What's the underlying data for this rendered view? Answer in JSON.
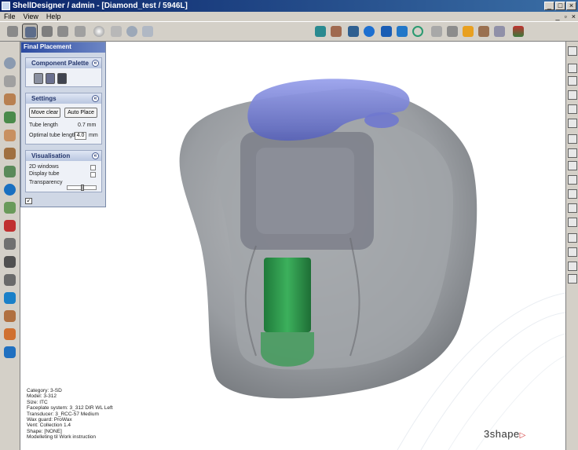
{
  "window": {
    "title": "ShellDesigner / admin - [Diamond_test / 5946L]",
    "buttons": [
      "_",
      "□",
      "×"
    ]
  },
  "menubar": {
    "items": [
      "File",
      "View",
      "Help"
    ],
    "mdi_controls": [
      "_",
      "▫",
      "×"
    ]
  },
  "colors": {
    "title_bar": "#0a246a",
    "panel_bg": "#cfd7e5",
    "shell": "#8f9398",
    "faceplate_module": "#7a84d6",
    "component_green": "#2f9a4c"
  },
  "panel": {
    "title": "Final Placement",
    "component_palette": {
      "heading": "Component Palette",
      "collapse_glyph": "«"
    },
    "settings": {
      "heading": "Settings",
      "collapse_glyph": "«",
      "move_clear": "Move clear",
      "auto_place": "Auto Place",
      "tube_length_label": "Tube length",
      "tube_length_value": "0.7 mm",
      "optimal_tube_length_label": "Optimal tube length",
      "optimal_tube_length_value": "4.0",
      "optimal_tube_length_unit": "mm"
    },
    "visualisation": {
      "heading": "Visualisation",
      "collapse_glyph": "«",
      "windows_2d": "2D windows",
      "display_tube": "Display tube",
      "transparency": "Transparency",
      "transparency_level": 0.5
    }
  },
  "info": {
    "lines": [
      "Category: 3-SD",
      "Model: 3-312",
      "Size: ITC",
      "Faceplate system: 3_312 DIR WL Left",
      "Transducer: 3_RCC-57 Medium",
      "Wax guard: ProWax",
      "Vent: Collection 1.4",
      "Shape: [NONE]",
      "Modelleting til Work instruction"
    ]
  },
  "brand": {
    "name": "3shape",
    "mark": "▷"
  }
}
